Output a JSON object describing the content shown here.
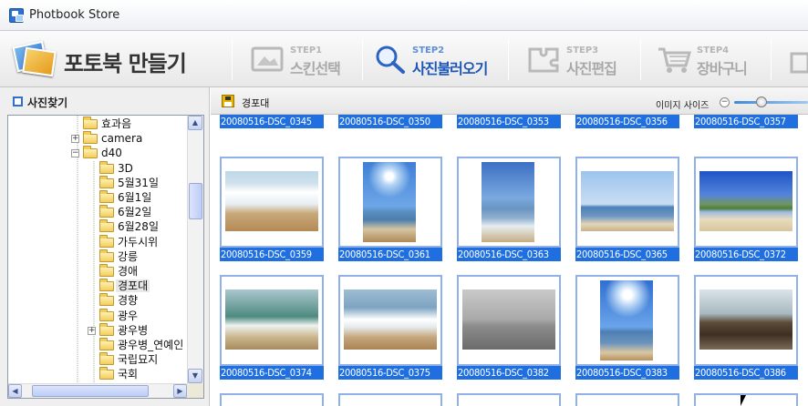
{
  "window": {
    "title": "Photbook Store"
  },
  "header": {
    "logo_text": "포토북 만들기",
    "steps": [
      {
        "num": "STEP1",
        "label": "스킨선택",
        "icon": "skin-frame-icon"
      },
      {
        "num": "STEP2",
        "label": "사진불러오기",
        "icon": "magnifier-icon"
      },
      {
        "num": "STEP3",
        "label": "사진편집",
        "icon": "puzzle-edit-icon"
      },
      {
        "num": "STEP4",
        "label": "장바구니",
        "icon": "cart-icon"
      }
    ],
    "active_step": "STEP2"
  },
  "left_panel": {
    "title": "사진찾기",
    "tree": [
      {
        "name": "효과음",
        "level": 1,
        "expander": ""
      },
      {
        "name": "camera",
        "level": 1,
        "expander": "+"
      },
      {
        "name": "d40",
        "level": 1,
        "expander": "-"
      },
      {
        "name": "3D",
        "level": 2,
        "expander": ""
      },
      {
        "name": "5월31일",
        "level": 2,
        "expander": ""
      },
      {
        "name": "6월1일",
        "level": 2,
        "expander": ""
      },
      {
        "name": "6월2일",
        "level": 2,
        "expander": ""
      },
      {
        "name": "6월28일",
        "level": 2,
        "expander": ""
      },
      {
        "name": "가두시위",
        "level": 2,
        "expander": ""
      },
      {
        "name": "강릉",
        "level": 2,
        "expander": ""
      },
      {
        "name": "경애",
        "level": 2,
        "expander": ""
      },
      {
        "name": "경포대",
        "level": 2,
        "expander": "",
        "selected": true
      },
      {
        "name": "경향",
        "level": 2,
        "expander": ""
      },
      {
        "name": "광우",
        "level": 2,
        "expander": ""
      },
      {
        "name": "광우병",
        "level": 2,
        "expander": "+"
      },
      {
        "name": "광우병_연예인",
        "level": 2,
        "expander": ""
      },
      {
        "name": "국립묘지",
        "level": 2,
        "expander": ""
      },
      {
        "name": "국회",
        "level": 2,
        "expander": ""
      }
    ]
  },
  "right_panel": {
    "current_folder": "경포대",
    "image_size_label": "이미지 사이즈",
    "image_size_level": 0.3,
    "photos": [
      {
        "caption": "20080516-DSC_0345",
        "style": "p-partial",
        "row": "top-partial"
      },
      {
        "caption": "20080516-DSC_0350",
        "style": "p-partial",
        "row": "top-partial"
      },
      {
        "caption": "20080516-DSC_0353",
        "style": "p-partial",
        "row": "top-partial"
      },
      {
        "caption": "20080516-DSC_0356",
        "style": "p-partial",
        "row": "top-partial"
      },
      {
        "caption": "20080516-DSC_0357",
        "style": "p-partial",
        "row": "top-partial"
      },
      {
        "caption": "20080516-DSC_0359",
        "style": "p-beach-surf",
        "orient": "landscape"
      },
      {
        "caption": "20080516-DSC_0361",
        "style": "p-sun-vert",
        "orient": "portrait"
      },
      {
        "caption": "20080516-DSC_0363",
        "style": "p-sea-vert",
        "orient": "portrait"
      },
      {
        "caption": "20080516-DSC_0365",
        "style": "p-calm",
        "orient": "landscape"
      },
      {
        "caption": "20080516-DSC_0372",
        "style": "p-island",
        "orient": "landscape"
      },
      {
        "caption": "20080516-DSC_0374",
        "style": "p-green-wave",
        "orient": "landscape"
      },
      {
        "caption": "20080516-DSC_0375",
        "style": "p-foam",
        "orient": "landscape"
      },
      {
        "caption": "20080516-DSC_0382",
        "style": "p-fog",
        "orient": "landscape"
      },
      {
        "caption": "20080516-DSC_0383",
        "style": "p-sun-vert2",
        "orient": "portrait"
      },
      {
        "caption": "20080516-DSC_0386",
        "style": "p-deck",
        "orient": "landscape"
      }
    ]
  },
  "colors": {
    "selection_blue": "#1f6fe0",
    "frame_border": "#8fb0e8",
    "active_step_text": "#1d56b8"
  }
}
